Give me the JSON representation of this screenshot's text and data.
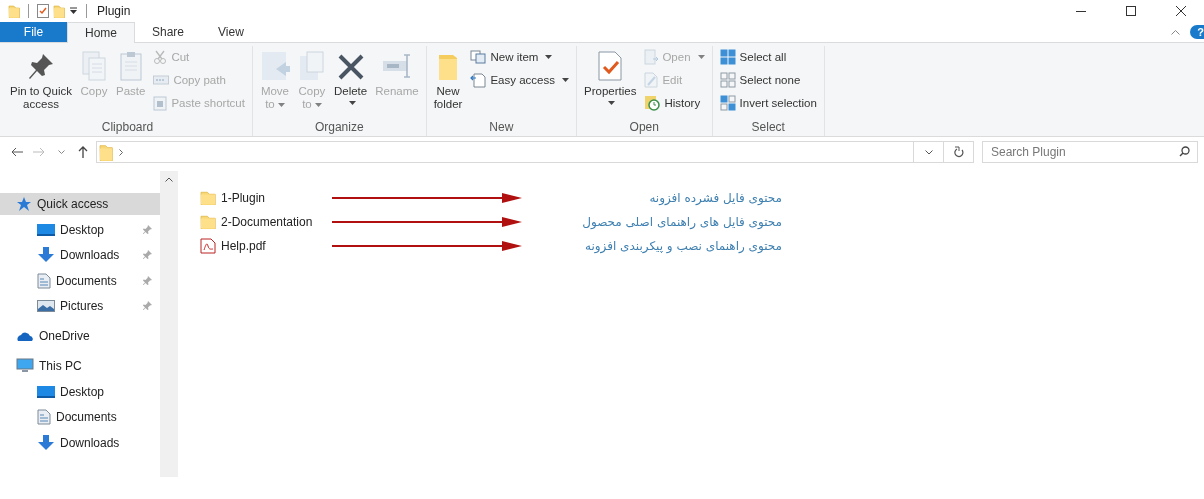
{
  "window": {
    "title": "Plugin"
  },
  "ribbon_tabs": [
    {
      "label": "File",
      "kind": "file",
      "selected": false
    },
    {
      "label": "Home",
      "kind": "tab",
      "selected": true
    },
    {
      "label": "Share",
      "kind": "tab",
      "selected": false
    },
    {
      "label": "View",
      "kind": "tab",
      "selected": false
    }
  ],
  "help_button": "?",
  "ribbon_groups": [
    {
      "label": "Clipboard",
      "commands": [
        {
          "label": "Pin to Quick\naccess",
          "kind": "large",
          "disabled": false,
          "dropdown": false
        },
        {
          "label": "Copy",
          "kind": "large",
          "disabled": true,
          "dropdown": false
        },
        {
          "label": "Paste",
          "kind": "large",
          "disabled": true,
          "dropdown": false
        },
        {
          "label": "Cut",
          "kind": "small",
          "disabled": true,
          "dropdown": false
        },
        {
          "label": "Copy path",
          "kind": "small",
          "disabled": true,
          "dropdown": false
        },
        {
          "label": "Paste shortcut",
          "kind": "small",
          "disabled": true,
          "dropdown": false
        }
      ]
    },
    {
      "label": "Organize",
      "commands": [
        {
          "label": "Move\nto",
          "kind": "large",
          "disabled": true,
          "dropdown": true
        },
        {
          "label": "Copy\nto",
          "kind": "large",
          "disabled": true,
          "dropdown": true
        },
        {
          "label": "Delete",
          "kind": "large",
          "disabled": false,
          "dropdown": true
        },
        {
          "label": "Rename",
          "kind": "large",
          "disabled": true,
          "dropdown": false
        }
      ]
    },
    {
      "label": "New",
      "commands": [
        {
          "label": "New\nfolder",
          "kind": "large",
          "disabled": false,
          "dropdown": false
        },
        {
          "label": "New item",
          "kind": "small",
          "disabled": false,
          "dropdown": true
        },
        {
          "label": "Easy access",
          "kind": "small",
          "disabled": false,
          "dropdown": true
        }
      ]
    },
    {
      "label": "Open",
      "commands": [
        {
          "label": "Properties",
          "kind": "large",
          "disabled": false,
          "dropdown": true
        },
        {
          "label": "Open",
          "kind": "small",
          "disabled": true,
          "dropdown": true
        },
        {
          "label": "Edit",
          "kind": "small",
          "disabled": true,
          "dropdown": false
        },
        {
          "label": "History",
          "kind": "small",
          "disabled": false,
          "dropdown": false
        }
      ]
    },
    {
      "label": "Select",
      "commands": [
        {
          "label": "Select all",
          "kind": "small",
          "disabled": false,
          "dropdown": false
        },
        {
          "label": "Select none",
          "kind": "small",
          "disabled": false,
          "dropdown": false
        },
        {
          "label": "Invert selection",
          "kind": "small",
          "disabled": false,
          "dropdown": false
        }
      ]
    }
  ],
  "search": {
    "placeholder": "Search Plugin"
  },
  "navigation": [
    {
      "label": "Quick access",
      "kind": "star",
      "selected": true,
      "children": [
        {
          "label": "Desktop",
          "kind": "desktop",
          "pinned": true,
          "selected": false
        },
        {
          "label": "Downloads",
          "kind": "download",
          "pinned": true,
          "selected": false
        },
        {
          "label": "Documents",
          "kind": "document",
          "pinned": true,
          "selected": false
        },
        {
          "label": "Pictures",
          "kind": "pictures",
          "pinned": true,
          "selected": false
        }
      ]
    },
    {
      "label": "OneDrive",
      "kind": "cloud",
      "selected": false
    },
    {
      "label": "This PC",
      "kind": "pc",
      "selected": false,
      "children": [
        {
          "label": "Desktop",
          "kind": "desktop",
          "pinned": false,
          "selected": false
        },
        {
          "label": "Documents",
          "kind": "document",
          "pinned": false,
          "selected": false
        },
        {
          "label": "Downloads",
          "kind": "download",
          "pinned": false,
          "selected": false
        }
      ]
    }
  ],
  "files": [
    {
      "name": "1-Plugin",
      "kind": "folder",
      "annotation": "محتوی فایل فشرده افزونه"
    },
    {
      "name": "2-Documentation",
      "kind": "folder",
      "annotation": "محتوی فایل های راهنمای اصلی محصول"
    },
    {
      "name": "Help.pdf",
      "kind": "pdf",
      "annotation": "محتوی راهنمای نصب و پیکربندی افزونه"
    }
  ]
}
